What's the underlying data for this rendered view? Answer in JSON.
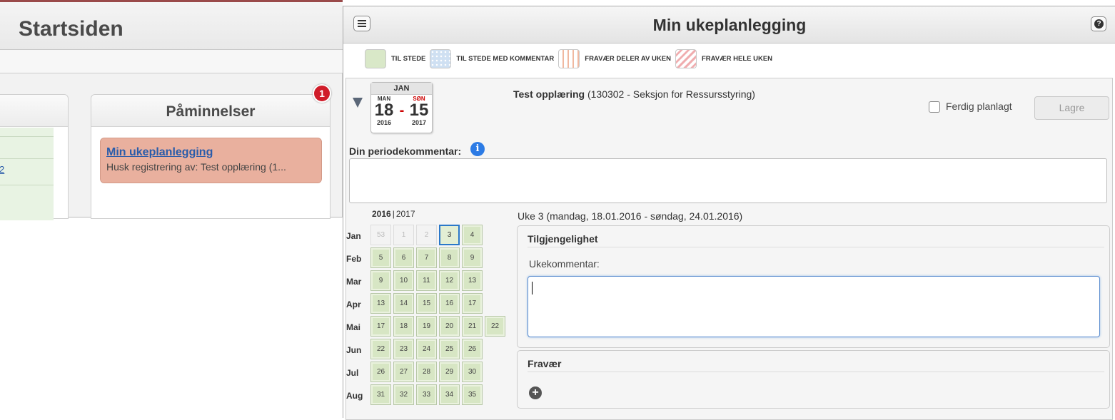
{
  "background": {
    "page_title": "Startsiden",
    "reminders_panel": {
      "title": "Påminnelser",
      "badge_count": "1",
      "item": {
        "link": "Min ukeplanlegging",
        "text": "Husk registrering av: Test opplæring (1..."
      }
    },
    "left_panel_fragment": "2"
  },
  "dialog": {
    "title": "Min ukeplanlegging",
    "legend": [
      {
        "key": "present",
        "label": "TIL STEDE"
      },
      {
        "key": "comment",
        "label": "TIL STEDE MED KOMMENTAR"
      },
      {
        "key": "partial",
        "label": "FRAVÆR DELER AV UKEN"
      },
      {
        "key": "whole",
        "label": "FRAVÆR HELE UKEN"
      }
    ],
    "period": {
      "month": "JAN",
      "start_weekday": "MAN",
      "start_day": "18",
      "start_year": "2016",
      "separator": "-",
      "end_weekday": "SØN",
      "end_day": "15",
      "end_year": "2017"
    },
    "course": {
      "name": "Test opplæring",
      "detail": "(130302 - Seksjon for Ressursstyring)"
    },
    "done_label": "Ferdig planlagt",
    "done_checked": false,
    "save_label": "Lagre",
    "period_comment_label": "Din periodekommentar:",
    "period_comment_value": "",
    "years": {
      "current": "2016",
      "separator": "|",
      "next": "2017"
    },
    "weeks": [
      {
        "month": "Jan",
        "weeks": [
          {
            "n": "53",
            "state": "off"
          },
          {
            "n": "1",
            "state": "off"
          },
          {
            "n": "2",
            "state": "off"
          },
          {
            "n": "3",
            "state": "selected"
          },
          {
            "n": "4",
            "state": "present"
          }
        ]
      },
      {
        "month": "Feb",
        "weeks": [
          {
            "n": "5",
            "state": "present"
          },
          {
            "n": "6",
            "state": "present"
          },
          {
            "n": "7",
            "state": "present"
          },
          {
            "n": "8",
            "state": "present"
          },
          {
            "n": "9",
            "state": "present"
          }
        ]
      },
      {
        "month": "Mar",
        "weeks": [
          {
            "n": "9",
            "state": "present"
          },
          {
            "n": "10",
            "state": "present"
          },
          {
            "n": "11",
            "state": "present"
          },
          {
            "n": "12",
            "state": "present"
          },
          {
            "n": "13",
            "state": "present"
          }
        ]
      },
      {
        "month": "Apr",
        "weeks": [
          {
            "n": "13",
            "state": "present"
          },
          {
            "n": "14",
            "state": "present"
          },
          {
            "n": "15",
            "state": "present"
          },
          {
            "n": "16",
            "state": "present"
          },
          {
            "n": "17",
            "state": "present"
          }
        ]
      },
      {
        "month": "Mai",
        "weeks": [
          {
            "n": "17",
            "state": "present"
          },
          {
            "n": "18",
            "state": "present"
          },
          {
            "n": "19",
            "state": "present"
          },
          {
            "n": "20",
            "state": "present"
          },
          {
            "n": "21",
            "state": "present"
          },
          {
            "n": "22",
            "state": "present"
          }
        ]
      },
      {
        "month": "Jun",
        "weeks": [
          {
            "n": "22",
            "state": "present"
          },
          {
            "n": "23",
            "state": "present"
          },
          {
            "n": "24",
            "state": "present"
          },
          {
            "n": "25",
            "state": "present"
          },
          {
            "n": "26",
            "state": "present"
          }
        ]
      },
      {
        "month": "Jul",
        "weeks": [
          {
            "n": "26",
            "state": "present"
          },
          {
            "n": "27",
            "state": "present"
          },
          {
            "n": "28",
            "state": "present"
          },
          {
            "n": "29",
            "state": "present"
          },
          {
            "n": "30",
            "state": "present"
          }
        ]
      },
      {
        "month": "Aug",
        "weeks": [
          {
            "n": "31",
            "state": "present"
          },
          {
            "n": "32",
            "state": "present"
          },
          {
            "n": "33",
            "state": "present"
          },
          {
            "n": "34",
            "state": "present"
          },
          {
            "n": "35",
            "state": "present"
          }
        ]
      }
    ],
    "week_title": "Uke 3 (mandag, 18.01.2016 - søndag, 24.01.2016)",
    "availability": {
      "heading": "Tilgjengelighet",
      "week_comment_label": "Ukekommentar:",
      "week_comment_value": ""
    },
    "absence": {
      "heading": "Fravær"
    }
  }
}
